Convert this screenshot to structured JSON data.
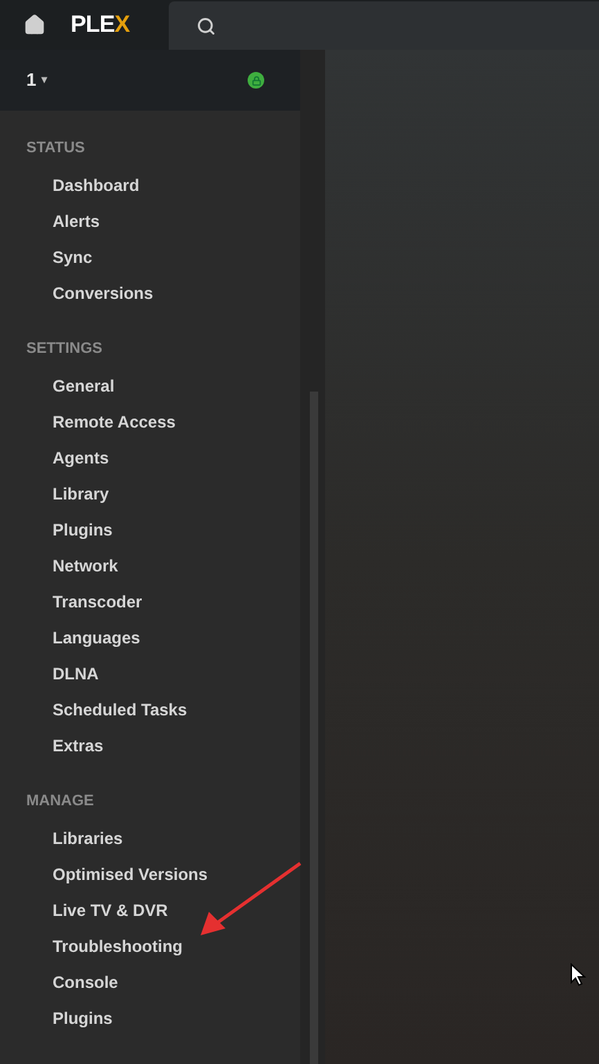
{
  "top_bar": {
    "logo": {
      "text": "PLE",
      "accent": "X"
    }
  },
  "server": {
    "name": "1",
    "dropdown": "▾"
  },
  "sidebar": {
    "sections": [
      {
        "title": "STATUS",
        "items": [
          "Dashboard",
          "Alerts",
          "Sync",
          "Conversions"
        ]
      },
      {
        "title": "SETTINGS",
        "items": [
          "General",
          "Remote Access",
          "Agents",
          "Library",
          "Plugins",
          "Network",
          "Transcoder",
          "Languages",
          "DLNA",
          "Scheduled Tasks",
          "Extras"
        ]
      },
      {
        "title": "MANAGE",
        "items": [
          "Libraries",
          "Optimised Versions",
          "Live TV & DVR",
          "Troubleshooting",
          "Console",
          "Plugins"
        ]
      }
    ]
  }
}
